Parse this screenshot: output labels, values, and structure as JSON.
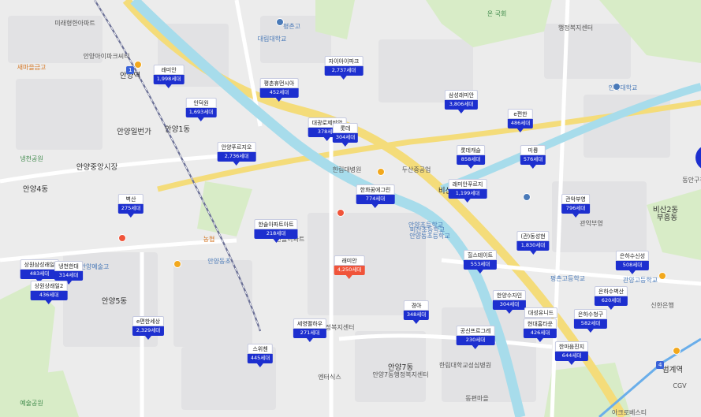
{
  "map": {
    "colors": {
      "land": "#ececec",
      "block": "#e2e2e4",
      "park": "#d8ecc7",
      "water": "#a7dceb",
      "road_major": "#f4dc7a",
      "road_main": "#ffffff",
      "rail": "#6a6f95",
      "marker_blue": "#1d2fcf",
      "marker_red": "#f0543a"
    },
    "markers": [
      {
        "name": "래미안",
        "units": "1,998세대",
        "color": "blue"
      },
      {
        "name": "자이아이파크",
        "units": "2,737세대",
        "color": "blue"
      },
      {
        "name": "평촌휴먼시아",
        "units": "452세대",
        "color": "blue"
      },
      {
        "name": "인덕원",
        "units": "1,693세대",
        "color": "blue"
      },
      {
        "name": "대광로제비앙",
        "units": "378세대",
        "color": "blue"
      },
      {
        "name": "롯데",
        "units": "304세대",
        "color": "blue"
      },
      {
        "name": "삼성래미안",
        "units": "3,806세대",
        "color": "blue"
      },
      {
        "name": "e편한",
        "units": "486세대",
        "color": "blue"
      },
      {
        "name": "안양푸르지오",
        "units": "2,736세대",
        "color": "blue"
      },
      {
        "name": "롯데캐슬",
        "units": "858세대",
        "color": "blue"
      },
      {
        "name": "미륭",
        "units": "576세대",
        "color": "blue"
      },
      {
        "name": "한화꿈에그린",
        "units": "774세대",
        "color": "blue"
      },
      {
        "name": "래미안푸르지",
        "units": "1,199세대",
        "color": "blue"
      },
      {
        "name": "벽산",
        "units": "275세대",
        "color": "blue"
      },
      {
        "name": "관악부영",
        "units": "796세대",
        "color": "blue"
      },
      {
        "name": "한솔아파트아트",
        "units": "218세대",
        "color": "blue"
      },
      {
        "name": "(관)동성현",
        "units": "1,830세대",
        "color": "blue"
      },
      {
        "name": "힐스테이트",
        "units": "553세대",
        "color": "blue"
      },
      {
        "name": "은하수신성",
        "units": "508세대",
        "color": "blue"
      },
      {
        "name": "래미안",
        "units": "4,250세대",
        "color": "red"
      },
      {
        "name": "상원삼성래일",
        "units": "483세대",
        "color": "blue"
      },
      {
        "name": "냉천한대",
        "units": "314세대",
        "color": "blue"
      },
      {
        "name": "상원상래일2",
        "units": "436세대",
        "color": "blue"
      },
      {
        "name": "한양수자인",
        "units": "304세대",
        "color": "blue"
      },
      {
        "name": "은하수벽산",
        "units": "620세대",
        "color": "blue"
      },
      {
        "name": "e편한세상",
        "units": "2,329세대",
        "color": "blue"
      },
      {
        "name": "경아",
        "units": "348세대",
        "color": "blue"
      },
      {
        "name": "대성유니드",
        "units": "",
        "color": "blue"
      },
      {
        "name": "은하수청구",
        "units": "582세대",
        "color": "blue"
      },
      {
        "name": "현대홈타운",
        "units": "426세대",
        "color": "blue"
      },
      {
        "name": "세영팰하우",
        "units": "271세대",
        "color": "blue"
      },
      {
        "name": "공신프르그레",
        "units": "230세대",
        "color": "blue"
      },
      {
        "name": "한마음진지",
        "units": "644세대",
        "color": "blue"
      },
      {
        "name": "스위첸",
        "units": "445세대",
        "color": "blue"
      }
    ],
    "labels": [
      {
        "text": "미래형한아파트",
        "style": ""
      },
      {
        "text": "안양아이파크씨티",
        "style": ""
      },
      {
        "text": "대림대학교",
        "style": "blue"
      },
      {
        "text": "평촌고",
        "style": "blue"
      },
      {
        "text": "온 국회",
        "style": "green"
      },
      {
        "text": "행정복지센터",
        "style": ""
      },
      {
        "text": "안양역",
        "style": "big"
      },
      {
        "text": "안양1동",
        "style": "big"
      },
      {
        "text": "안양일번가",
        "style": "big"
      },
      {
        "text": "안양중앙시장",
        "style": "big"
      },
      {
        "text": "안양4동",
        "style": "big"
      },
      {
        "text": "안양5동",
        "style": "big"
      },
      {
        "text": "안양7동",
        "style": "big"
      },
      {
        "text": "비산3동",
        "style": "big"
      },
      {
        "text": "관악부영",
        "style": ""
      },
      {
        "text": "비산초등학교",
        "style": "blue"
      },
      {
        "text": "두산중공업",
        "style": ""
      },
      {
        "text": "평촌고등학교",
        "style": "blue"
      },
      {
        "text": "비산2동",
        "style": "big"
      },
      {
        "text": "신한은행",
        "style": ""
      },
      {
        "text": "한림대학교성심병원",
        "style": ""
      },
      {
        "text": "안양동초등학교",
        "style": "blue"
      },
      {
        "text": "새마을금고",
        "style": "orange"
      },
      {
        "text": "냉천공원",
        "style": "green"
      },
      {
        "text": "안양예술고",
        "style": "blue"
      },
      {
        "text": "농협",
        "style": "orange"
      },
      {
        "text": "한솔아파트",
        "style": ""
      },
      {
        "text": "석수행정복지센터",
        "style": ""
      },
      {
        "text": "안양동초",
        "style": "blue"
      },
      {
        "text": "동안구청",
        "style": ""
      },
      {
        "text": "부흥동",
        "style": "big"
      },
      {
        "text": "관양고등학교",
        "style": "blue"
      },
      {
        "text": "안양대학교",
        "style": "blue"
      },
      {
        "text": "범계역",
        "style": "big"
      },
      {
        "text": "CGV",
        "style": ""
      },
      {
        "text": "아크로베스티",
        "style": ""
      },
      {
        "text": "한림대병원",
        "style": ""
      },
      {
        "text": "안양7동행정복지센터",
        "style": ""
      },
      {
        "text": "예술공원",
        "style": "green"
      },
      {
        "text": "동편마을",
        "style": ""
      },
      {
        "text": "안양초등학교",
        "style": "blue"
      },
      {
        "text": "엔터식스",
        "style": ""
      }
    ]
  }
}
